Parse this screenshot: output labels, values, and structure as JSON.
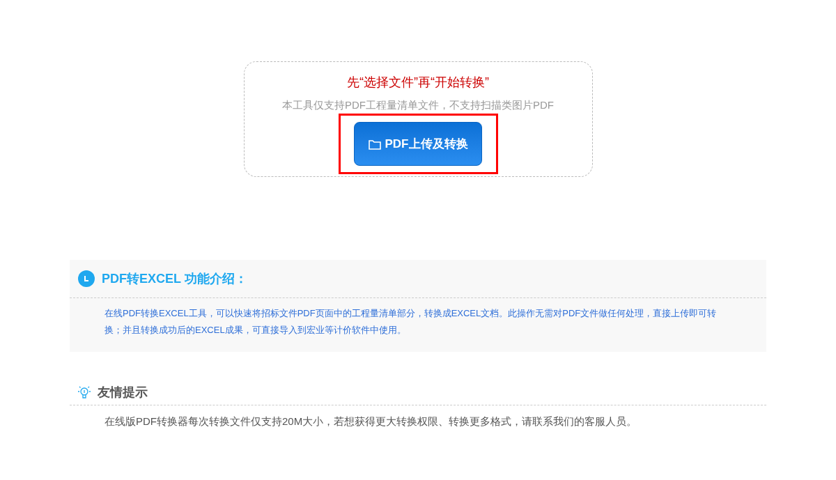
{
  "upload": {
    "heading": "先“选择文件”再“开始转换”",
    "note": "本工具仅支持PDF工程量清单文件，不支持扫描类图片PDF",
    "button": "PDF上传及转换",
    "highlighted": true
  },
  "intro": {
    "title": "PDF转EXCEL 功能介绍：",
    "body": "在线PDF转换EXCEL工具，可以快速将招标文件PDF页面中的工程量清单部分，转换成EXCEL文档。此操作无需对PDF文件做任何处理，直接上传即可转换；并且转换成功后的EXCEL成果，可直接导入到宏业等计价软件中使用。"
  },
  "tips": {
    "title": "友情提示",
    "body": "在线版PDF转换器每次转换文件仅支持20M大小，若想获得更大转换权限、转换更多格式，请联系我们的客服人员。"
  }
}
